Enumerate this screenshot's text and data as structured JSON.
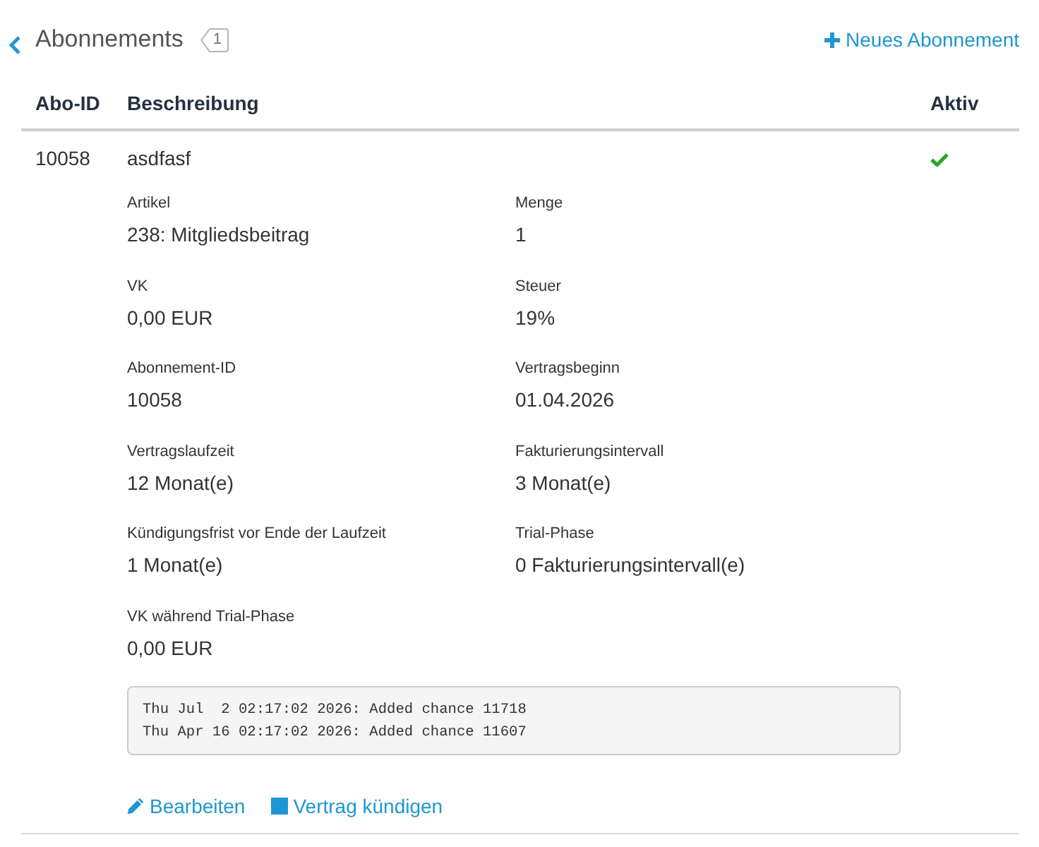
{
  "header": {
    "title": "Abonnements",
    "count": "1",
    "new_link": "Neues Abonnement"
  },
  "table": {
    "columns": [
      "Abo-ID",
      "Beschreibung",
      "Aktiv"
    ],
    "rows": [
      {
        "id": "10058",
        "description": "asdfasf",
        "active": true,
        "details": [
          {
            "label": "Artikel",
            "value": "238: Mitgliedsbeitrag"
          },
          {
            "label": "Menge",
            "value": "1"
          },
          {
            "label": "VK",
            "value": "0,00 EUR"
          },
          {
            "label": "Steuer",
            "value": "19%"
          },
          {
            "label": "Abonnement-ID",
            "value": "10058"
          },
          {
            "label": "Vertragsbeginn",
            "value": "01.04.2026"
          },
          {
            "label": "Vertragslaufzeit",
            "value": "12 Monat(e)"
          },
          {
            "label": "Fakturierungsintervall",
            "value": "3 Monat(e)"
          },
          {
            "label": "Kündigungsfrist vor Ende der Laufzeit",
            "value": "1 Monat(e)"
          },
          {
            "label": "Trial-Phase",
            "value": "0 Fakturierungsintervall(e)"
          },
          {
            "label": "VK während Trial-Phase",
            "value": "0,00 EUR"
          }
        ],
        "log": [
          "Thu Jul  2 02:17:02 2026: Added chance 11718",
          "Thu Apr 16 02:17:02 2026: Added chance 11607"
        ],
        "actions": [
          {
            "kind": "edit",
            "label": "Bearbeiten"
          },
          {
            "kind": "cancel",
            "label": "Vertrag kündigen"
          }
        ]
      }
    ]
  }
}
